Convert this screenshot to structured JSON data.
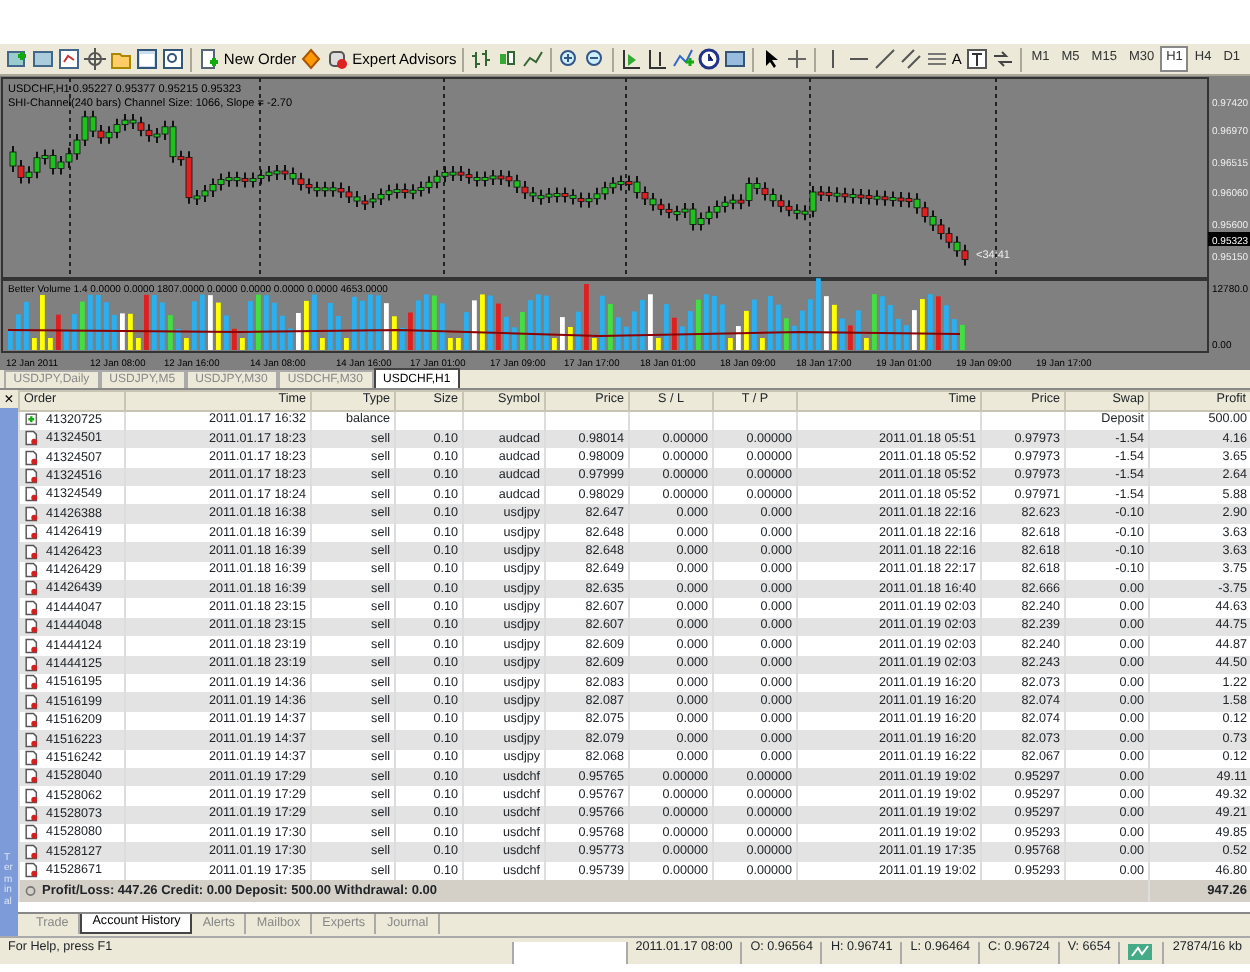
{
  "toolbar": {
    "new_order": "New Order",
    "expert_advisors": "Expert Advisors",
    "text_tool": "A",
    "timeframes": [
      {
        "label": "M1",
        "selected": false
      },
      {
        "label": "M5",
        "selected": false
      },
      {
        "label": "M15",
        "selected": false
      },
      {
        "label": "M30",
        "selected": false
      },
      {
        "label": "H1",
        "selected": true
      },
      {
        "label": "H4",
        "selected": false
      },
      {
        "label": "D1",
        "selected": false
      }
    ]
  },
  "chart": {
    "legend": [
      "USDCHF,H1  0.95227 0.95377 0.95215 0.95323",
      "SHI-Channel(240 bars) Channel Size: 1066, Slope = -2.70"
    ],
    "price_labels": [
      "0.97420",
      "0.96970",
      "0.96515",
      "0.96060",
      "0.95600",
      "0.95323",
      "0.95150"
    ],
    "countdown": "<34:41",
    "volume_legend": "Better Volume 1.4 0.0000 0.0000 1807.0000 0.0000 0.0000 0.0000 0.0000 4653.0000",
    "volume_labels": [
      "12780.0",
      "0.00"
    ],
    "time_labels": [
      "12 Jan 2011",
      "12 Jan 08:00",
      "12 Jan 16:00",
      "14 Jan 08:00",
      "14 Jan 16:00",
      "17 Jan 01:00",
      "17 Jan 09:00",
      "17 Jan 17:00",
      "18 Jan 01:00",
      "18 Jan 09:00",
      "18 Jan 17:00",
      "19 Jan 01:00",
      "19 Jan 09:00",
      "19 Jan 17:00"
    ]
  },
  "chart_tabs": [
    {
      "label": "USDJPY,Daily",
      "selected": false
    },
    {
      "label": "USDJPY,M5",
      "selected": false
    },
    {
      "label": "USDJPY,M30",
      "selected": false
    },
    {
      "label": "USDCHF,M30",
      "selected": false
    },
    {
      "label": "USDCHF,H1",
      "selected": true
    }
  ],
  "terminal": {
    "close": "×",
    "side_label": "Terminal",
    "columns": [
      "Order",
      "Time",
      "Type",
      "Size",
      "Symbol",
      "Price",
      "S / L",
      "T / P",
      "Time",
      "Price",
      "Swap",
      "Profit"
    ],
    "rows": [
      {
        "kind": "balance",
        "cells": [
          "41320725",
          "2011.01.17 16:32",
          "balance",
          "",
          "",
          "",
          "",
          "",
          "",
          "",
          "Deposit",
          "500.00"
        ]
      },
      {
        "kind": "trade",
        "cells": [
          "41324501",
          "2011.01.17 18:23",
          "sell",
          "0.10",
          "audcad",
          "0.98014",
          "0.00000",
          "0.00000",
          "2011.01.18 05:51",
          "0.97973",
          "-1.54",
          "4.16"
        ]
      },
      {
        "kind": "trade",
        "cells": [
          "41324507",
          "2011.01.17 18:23",
          "sell",
          "0.10",
          "audcad",
          "0.98009",
          "0.00000",
          "0.00000",
          "2011.01.18 05:52",
          "0.97973",
          "-1.54",
          "3.65"
        ]
      },
      {
        "kind": "trade",
        "cells": [
          "41324516",
          "2011.01.17 18:23",
          "sell",
          "0.10",
          "audcad",
          "0.97999",
          "0.00000",
          "0.00000",
          "2011.01.18 05:52",
          "0.97973",
          "-1.54",
          "2.64"
        ]
      },
      {
        "kind": "trade",
        "cells": [
          "41324549",
          "2011.01.17 18:24",
          "sell",
          "0.10",
          "audcad",
          "0.98029",
          "0.00000",
          "0.00000",
          "2011.01.18 05:52",
          "0.97971",
          "-1.54",
          "5.88"
        ]
      },
      {
        "kind": "trade",
        "cells": [
          "41426388",
          "2011.01.18 16:38",
          "sell",
          "0.10",
          "usdjpy",
          "82.647",
          "0.000",
          "0.000",
          "2011.01.18 22:16",
          "82.623",
          "-0.10",
          "2.90"
        ]
      },
      {
        "kind": "trade",
        "cells": [
          "41426419",
          "2011.01.18 16:39",
          "sell",
          "0.10",
          "usdjpy",
          "82.648",
          "0.000",
          "0.000",
          "2011.01.18 22:16",
          "82.618",
          "-0.10",
          "3.63"
        ]
      },
      {
        "kind": "trade",
        "cells": [
          "41426423",
          "2011.01.18 16:39",
          "sell",
          "0.10",
          "usdjpy",
          "82.648",
          "0.000",
          "0.000",
          "2011.01.18 22:16",
          "82.618",
          "-0.10",
          "3.63"
        ]
      },
      {
        "kind": "trade",
        "cells": [
          "41426429",
          "2011.01.18 16:39",
          "sell",
          "0.10",
          "usdjpy",
          "82.649",
          "0.000",
          "0.000",
          "2011.01.18 22:17",
          "82.618",
          "-0.10",
          "3.75"
        ]
      },
      {
        "kind": "trade",
        "cells": [
          "41426439",
          "2011.01.18 16:39",
          "sell",
          "0.10",
          "usdjpy",
          "82.635",
          "0.000",
          "0.000",
          "2011.01.18 16:40",
          "82.666",
          "0.00",
          "-3.75"
        ]
      },
      {
        "kind": "trade",
        "cells": [
          "41444047",
          "2011.01.18 23:15",
          "sell",
          "0.10",
          "usdjpy",
          "82.607",
          "0.000",
          "0.000",
          "2011.01.19 02:03",
          "82.240",
          "0.00",
          "44.63"
        ]
      },
      {
        "kind": "trade",
        "cells": [
          "41444048",
          "2011.01.18 23:15",
          "sell",
          "0.10",
          "usdjpy",
          "82.607",
          "0.000",
          "0.000",
          "2011.01.19 02:03",
          "82.239",
          "0.00",
          "44.75"
        ]
      },
      {
        "kind": "trade",
        "cells": [
          "41444124",
          "2011.01.18 23:19",
          "sell",
          "0.10",
          "usdjpy",
          "82.609",
          "0.000",
          "0.000",
          "2011.01.19 02:03",
          "82.240",
          "0.00",
          "44.87"
        ]
      },
      {
        "kind": "trade",
        "cells": [
          "41444125",
          "2011.01.18 23:19",
          "sell",
          "0.10",
          "usdjpy",
          "82.609",
          "0.000",
          "0.000",
          "2011.01.19 02:03",
          "82.243",
          "0.00",
          "44.50"
        ]
      },
      {
        "kind": "trade",
        "cells": [
          "41516195",
          "2011.01.19 14:36",
          "sell",
          "0.10",
          "usdjpy",
          "82.083",
          "0.000",
          "0.000",
          "2011.01.19 16:20",
          "82.073",
          "0.00",
          "1.22"
        ]
      },
      {
        "kind": "trade",
        "cells": [
          "41516199",
          "2011.01.19 14:36",
          "sell",
          "0.10",
          "usdjpy",
          "82.087",
          "0.000",
          "0.000",
          "2011.01.19 16:20",
          "82.074",
          "0.00",
          "1.58"
        ]
      },
      {
        "kind": "trade",
        "cells": [
          "41516209",
          "2011.01.19 14:37",
          "sell",
          "0.10",
          "usdjpy",
          "82.075",
          "0.000",
          "0.000",
          "2011.01.19 16:20",
          "82.074",
          "0.00",
          "0.12"
        ]
      },
      {
        "kind": "trade",
        "cells": [
          "41516223",
          "2011.01.19 14:37",
          "sell",
          "0.10",
          "usdjpy",
          "82.079",
          "0.000",
          "0.000",
          "2011.01.19 16:20",
          "82.073",
          "0.00",
          "0.73"
        ]
      },
      {
        "kind": "trade",
        "cells": [
          "41516242",
          "2011.01.19 14:37",
          "sell",
          "0.10",
          "usdjpy",
          "82.068",
          "0.000",
          "0.000",
          "2011.01.19 16:22",
          "82.067",
          "0.00",
          "0.12"
        ]
      },
      {
        "kind": "trade",
        "cells": [
          "41528040",
          "2011.01.19 17:29",
          "sell",
          "0.10",
          "usdchf",
          "0.95765",
          "0.00000",
          "0.00000",
          "2011.01.19 19:02",
          "0.95297",
          "0.00",
          "49.11"
        ]
      },
      {
        "kind": "trade",
        "cells": [
          "41528062",
          "2011.01.19 17:29",
          "sell",
          "0.10",
          "usdchf",
          "0.95767",
          "0.00000",
          "0.00000",
          "2011.01.19 19:02",
          "0.95297",
          "0.00",
          "49.32"
        ]
      },
      {
        "kind": "trade",
        "cells": [
          "41528073",
          "2011.01.19 17:29",
          "sell",
          "0.10",
          "usdchf",
          "0.95766",
          "0.00000",
          "0.00000",
          "2011.01.19 19:02",
          "0.95297",
          "0.00",
          "49.21"
        ]
      },
      {
        "kind": "trade",
        "cells": [
          "41528080",
          "2011.01.19 17:30",
          "sell",
          "0.10",
          "usdchf",
          "0.95768",
          "0.00000",
          "0.00000",
          "2011.01.19 19:02",
          "0.95293",
          "0.00",
          "49.85"
        ]
      },
      {
        "kind": "trade",
        "cells": [
          "41528127",
          "2011.01.19 17:30",
          "sell",
          "0.10",
          "usdchf",
          "0.95773",
          "0.00000",
          "0.00000",
          "2011.01.19 17:35",
          "0.95768",
          "0.00",
          "0.52"
        ]
      },
      {
        "kind": "trade",
        "cells": [
          "41528671",
          "2011.01.19 17:35",
          "sell",
          "0.10",
          "usdchf",
          "0.95739",
          "0.00000",
          "0.00000",
          "2011.01.19 19:02",
          "0.95293",
          "0.00",
          "46.80"
        ]
      }
    ],
    "summary": "**Profit/Loss: 447.26  Credit: 0.00  Deposit: 500.00  Withdrawal: 0.00**",
    "total": "947.26",
    "tabs": [
      {
        "label": "Trade",
        "selected": false
      },
      {
        "label": "Account History",
        "selected": true
      },
      {
        "label": "Alerts",
        "selected": false
      },
      {
        "label": "Mailbox",
        "selected": false
      },
      {
        "label": "Experts",
        "selected": false
      },
      {
        "label": "Journal",
        "selected": false
      }
    ]
  },
  "status_bar": [
    "For Help, press F1",
    "2011.01.17 08:00",
    "O: 0.96564",
    "H: 0.96741",
    "L: 0.96464",
    "C: 0.96724",
    "V: 6654",
    "27874/16 kb"
  ]
}
